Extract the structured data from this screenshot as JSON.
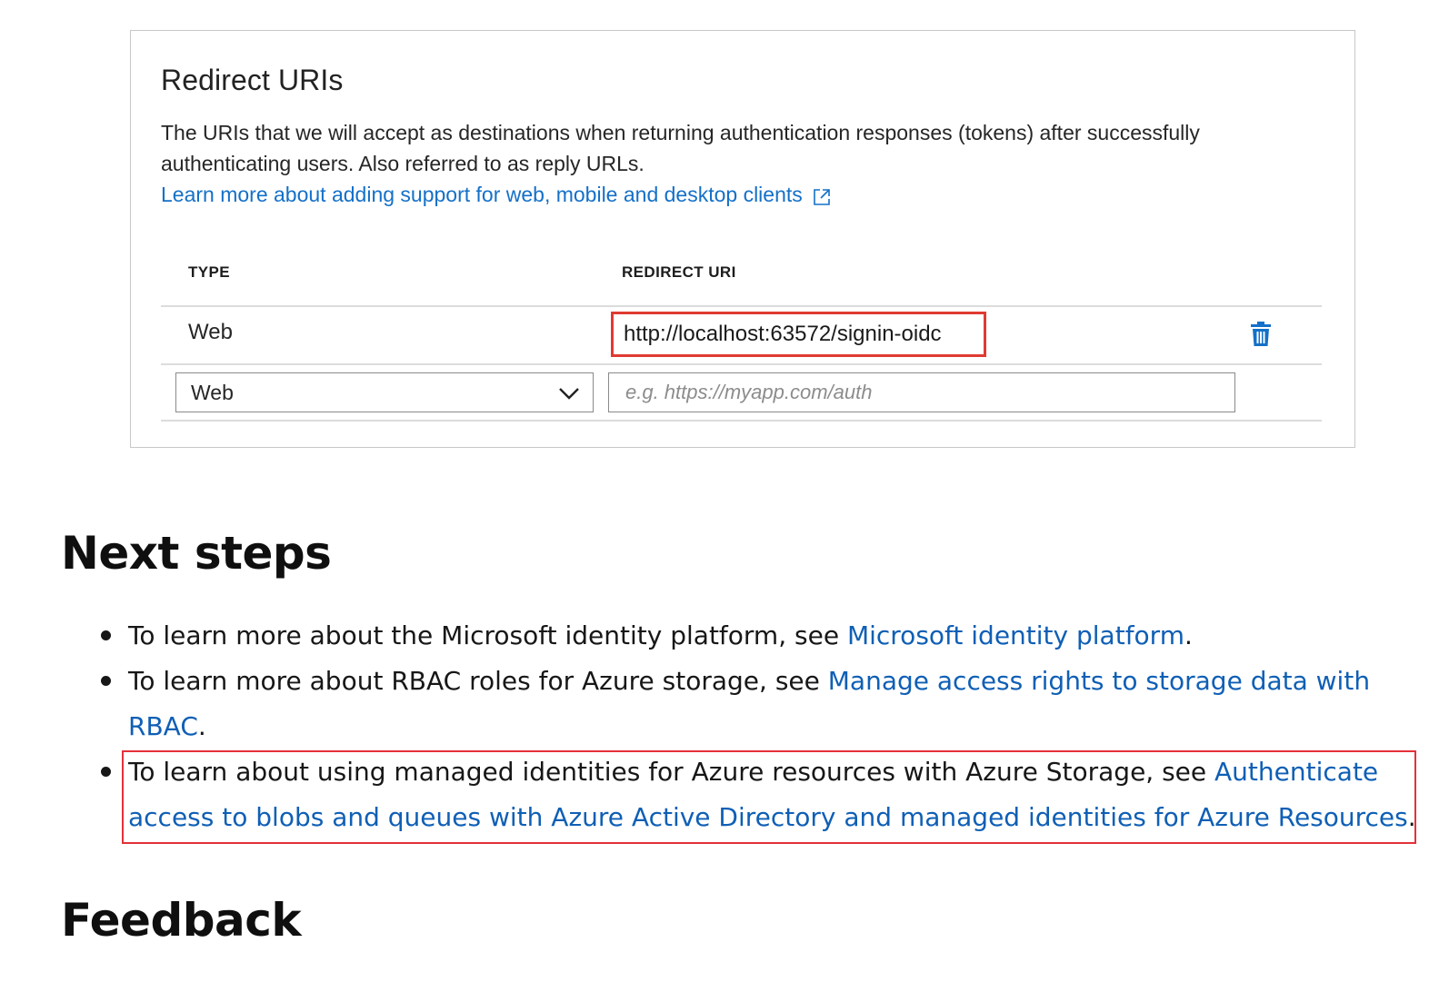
{
  "redirect_panel": {
    "title": "Redirect URIs",
    "description": "The URIs that we will accept as destinations when returning authentication responses (tokens) after successfully authenticating users. Also referred to as reply URLs.",
    "learn_more_link": "Learn more about adding support for web, mobile and desktop clients",
    "columns": {
      "type": "TYPE",
      "redirect_uri": "REDIRECT URI"
    },
    "rows": [
      {
        "type": "Web",
        "redirect_uri": "http://localhost:63572/signin-oidc"
      }
    ],
    "new_row": {
      "type_selected": "Web",
      "uri_placeholder": "e.g. https://myapp.com/auth",
      "uri_value": ""
    },
    "accent_color": "#1470c8",
    "highlight_color": "#e03a32"
  },
  "next_steps": {
    "heading": "Next steps",
    "items": [
      {
        "text_before": "To learn more about the Microsoft identity platform, see ",
        "link": "Microsoft identity platform",
        "text_after": "."
      },
      {
        "text_before": "To learn more about RBAC roles for Azure storage, see ",
        "link": "Manage access rights to storage data with RBAC",
        "text_after": "."
      },
      {
        "text_before": "To learn about using managed identities for Azure resources with Azure Storage, see ",
        "link": "Authenticate access to blobs and queues with Azure Active Directory and managed identities for Azure Resources",
        "text_after": "."
      }
    ]
  },
  "feedback": {
    "heading": "Feedback"
  },
  "icons": {
    "external_link": "external-link-icon",
    "delete": "trash-icon",
    "dropdown": "chevron-down-icon"
  }
}
